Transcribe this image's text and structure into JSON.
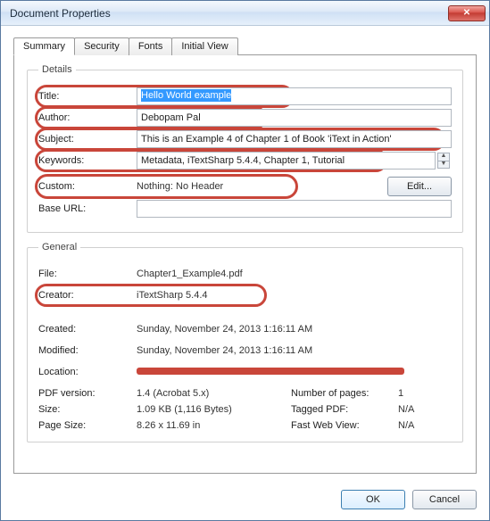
{
  "window": {
    "title": "Document Properties",
    "close_glyph": "✕"
  },
  "tabs": {
    "summary": "Summary",
    "security": "Security",
    "fonts": "Fonts",
    "initial_view": "Initial View"
  },
  "details": {
    "legend": "Details",
    "title_label": "Title:",
    "title_value": "Hello World example",
    "author_label": "Author:",
    "author_value": "Debopam Pal",
    "subject_label": "Subject:",
    "subject_value": "This is an Example 4 of Chapter 1 of Book 'iText in Action'",
    "keywords_label": "Keywords:",
    "keywords_value": "Metadata, iTextSharp 5.4.4, Chapter 1, Tutorial",
    "custom_label": "Custom:",
    "custom_value": "Nothing: No Header",
    "edit_label": "Edit...",
    "baseurl_label": "Base URL:",
    "baseurl_value": ""
  },
  "general": {
    "legend": "General",
    "file_label": "File:",
    "file_value": "Chapter1_Example4.pdf",
    "creator_label": "Creator:",
    "creator_value": "iTextSharp 5.4.4",
    "created_label": "Created:",
    "created_value": "Sunday, November 24, 2013 1:16:11 AM",
    "modified_label": "Modified:",
    "modified_value": "Sunday, November 24, 2013 1:16:11 AM",
    "location_label": "Location:",
    "pdfversion_label": "PDF version:",
    "pdfversion_value": "1.4 (Acrobat 5.x)",
    "numpages_label": "Number of pages:",
    "numpages_value": "1",
    "size_label": "Size:",
    "size_value": "1.09 KB (1,116 Bytes)",
    "tagged_label": "Tagged PDF:",
    "tagged_value": "N/A",
    "pagesize_label": "Page Size:",
    "pagesize_value": "8.26 x 11.69 in",
    "fastweb_label": "Fast Web View:",
    "fastweb_value": "N/A"
  },
  "buttons": {
    "ok": "OK",
    "cancel": "Cancel"
  }
}
